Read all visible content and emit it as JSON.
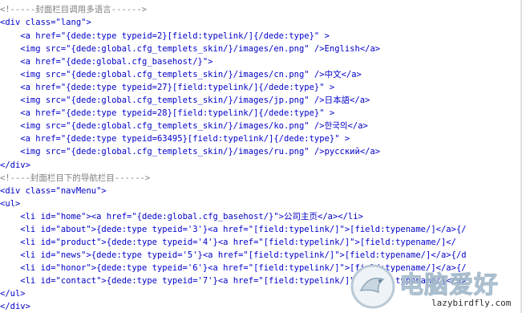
{
  "comment1": "<!-----封面栏目调用多语言------>",
  "lang_block": {
    "div_open": "<div class=\"lang\">",
    "lines": [
      "    <a href=\"{dede:type typeid=2}[field:typelink/]{/dede:type}\" >",
      "    <img src=\"{dede:global.cfg_templets_skin/}/images/en.png\" />English</a>",
      "    <a href=\"{dede:global.cfg_basehost/}\">",
      "    <img src=\"{dede:global.cfg_templets_skin/}/images/cn.png\" />中文</a>",
      "    <a href=\"{dede:type typeid=27}[field:typelink/]{/dede:type}\" >",
      "    <img src=\"{dede:global.cfg_templets_skin/}/images/jp.png\" />日本語</a>",
      "    <a href=\"{dede:type typeid=28}[field:typelink/]{/dede:type}\" >",
      "    <img src=\"{dede:global.cfg_templets_skin/}/images/ko.png\" />한국의</a>",
      "    <a href=\"{dede:type typeid=63495}[field:typelink/]{/dede:type}\" >",
      "    <img src=\"{dede:global.cfg_templets_skin/}/images/ru.png\" />русский</a>"
    ],
    "div_close": "</div>"
  },
  "comment2": "<!----封面栏目下的导航栏目------>",
  "nav_block": {
    "div_open": "<div class=\"navMenu\">",
    "ul_open": "<ul>",
    "lines": [
      "    <li id=\"home\"><a href=\"{dede:global.cfg_basehost/}\">公司主页</a></li>",
      "    <li id=\"about\">{dede:type typeid='3'}<a href=\"[field:typelink/]\">[field:typename/]</a>{/",
      "    <li id=\"product\">{dede:type typeid='4'}<a href=\"[field:typelink/]\">[field:typename/]</",
      "    <li id=\"news\">{dede:type typeid='5'}<a href=\"[field:typelink/]\">[field:typename/]</a>{/d",
      "    <li id=\"honor\">{dede:type typeid='6'}<a href=\"[field:typelink/]\">[field:typename/]</a>{/",
      "    <li id=\"contact\">{dede:type typeid='7'}<a href=\"[field:typelink/]\">[field:typename/]</a>"
    ],
    "ul_close": "</ul>",
    "div_close": "</div>"
  },
  "watermark": {
    "logo_text": "电脑爱好",
    "url": "lazybirdfly.com"
  },
  "colors": {
    "tag": "#0000c8",
    "string": "#8b00ff",
    "comment": "#808080",
    "background": "#ffffff"
  }
}
